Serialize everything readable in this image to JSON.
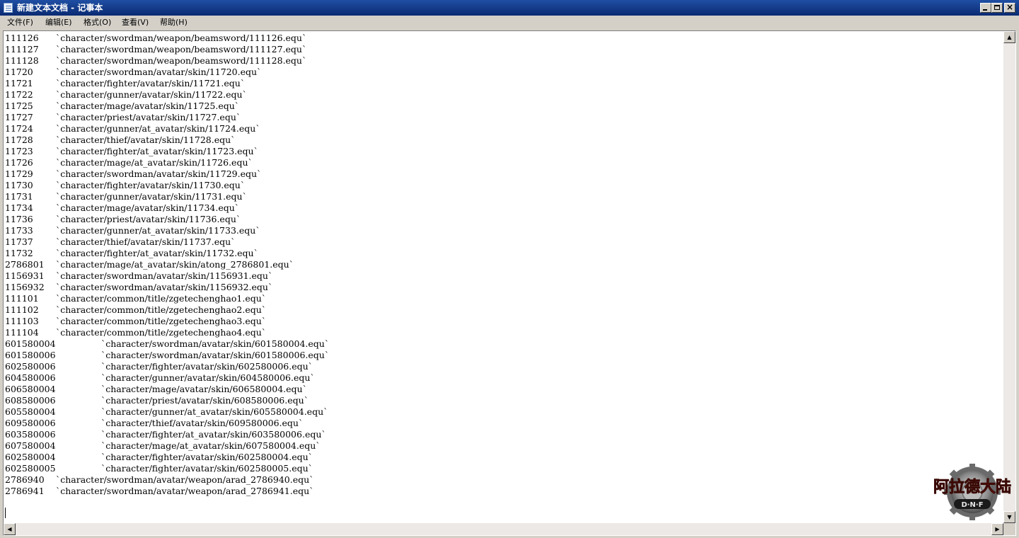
{
  "window": {
    "title": "新建文本文档 - 记事本"
  },
  "controls": {
    "minimize": "_",
    "maximize": "□",
    "close": "×"
  },
  "menu": [
    {
      "label": "文件(F)"
    },
    {
      "label": "编辑(E)"
    },
    {
      "label": "格式(O)"
    },
    {
      "label": "查看(V)"
    },
    {
      "label": "帮助(H)"
    }
  ],
  "lines": [
    {
      "id": "111126",
      "path": "`character/swordman/weapon/beamsword/111126.equ`"
    },
    {
      "id": "111127",
      "path": "`character/swordman/weapon/beamsword/111127.equ`"
    },
    {
      "id": "111128",
      "path": "`character/swordman/weapon/beamsword/111128.equ`"
    },
    {
      "id": "11720",
      "path": "`character/swordman/avatar/skin/11720.equ`"
    },
    {
      "id": "11721",
      "path": "`character/fighter/avatar/skin/11721.equ`"
    },
    {
      "id": "11722",
      "path": "`character/gunner/avatar/skin/11722.equ`"
    },
    {
      "id": "11725",
      "path": "`character/mage/avatar/skin/11725.equ`"
    },
    {
      "id": "11727",
      "path": "`character/priest/avatar/skin/11727.equ`"
    },
    {
      "id": "11724",
      "path": "`character/gunner/at_avatar/skin/11724.equ`"
    },
    {
      "id": "11728",
      "path": "`character/thief/avatar/skin/11728.equ`"
    },
    {
      "id": "11723",
      "path": "`character/fighter/at_avatar/skin/11723.equ`"
    },
    {
      "id": "11726",
      "path": "`character/mage/at_avatar/skin/11726.equ`"
    },
    {
      "id": "11729",
      "path": "`character/swordman/avatar/skin/11729.equ`"
    },
    {
      "id": "11730",
      "path": "`character/fighter/avatar/skin/11730.equ`"
    },
    {
      "id": "11731",
      "path": "`character/gunner/avatar/skin/11731.equ`"
    },
    {
      "id": "11734",
      "path": "`character/mage/avatar/skin/11734.equ`"
    },
    {
      "id": "11736",
      "path": "`character/priest/avatar/skin/11736.equ`"
    },
    {
      "id": "11733",
      "path": "`character/gunner/at_avatar/skin/11733.equ`"
    },
    {
      "id": "11737",
      "path": "`character/thief/avatar/skin/11737.equ`"
    },
    {
      "id": "11732",
      "path": "`character/fighter/at_avatar/skin/11732.equ`"
    },
    {
      "id": "2786801",
      "path": "`character/mage/at_avatar/skin/atong_2786801.equ`"
    },
    {
      "id": "1156931",
      "path": "`character/swordman/avatar/skin/1156931.equ`"
    },
    {
      "id": "1156932",
      "path": "`character/swordman/avatar/skin/1156932.equ`"
    },
    {
      "id": "111101",
      "path": "`character/common/title/zgetechenghao1.equ`"
    },
    {
      "id": "111102",
      "path": "`character/common/title/zgetechenghao2.equ`"
    },
    {
      "id": "111103",
      "path": "`character/common/title/zgetechenghao3.equ`"
    },
    {
      "id": "111104",
      "path": "`character/common/title/zgetechenghao4.equ`"
    },
    {
      "id": "601580004",
      "path": "`character/swordman/avatar/skin/601580004.equ`",
      "wide": true
    },
    {
      "id": "601580006",
      "path": "`character/swordman/avatar/skin/601580006.equ`",
      "wide": true
    },
    {
      "id": "602580006",
      "path": "`character/fighter/avatar/skin/602580006.equ`",
      "wide": true
    },
    {
      "id": "604580006",
      "path": "`character/gunner/avatar/skin/604580006.equ`",
      "wide": true
    },
    {
      "id": "606580004",
      "path": "`character/mage/avatar/skin/606580004.equ`",
      "wide": true
    },
    {
      "id": "608580006",
      "path": "`character/priest/avatar/skin/608580006.equ`",
      "wide": true
    },
    {
      "id": "605580004",
      "path": "`character/gunner/at_avatar/skin/605580004.equ`",
      "wide": true
    },
    {
      "id": "609580006",
      "path": "`character/thief/avatar/skin/609580006.equ`",
      "wide": true
    },
    {
      "id": "603580006",
      "path": "`character/fighter/at_avatar/skin/603580006.equ`",
      "wide": true
    },
    {
      "id": "607580004",
      "path": "`character/mage/at_avatar/skin/607580004.equ`",
      "wide": true
    },
    {
      "id": "602580004",
      "path": "`character/fighter/avatar/skin/602580004.equ`",
      "wide": true
    },
    {
      "id": "602580005",
      "path": "`character/fighter/avatar/skin/602580005.equ`",
      "wide": true
    },
    {
      "id": "2786940",
      "path": "`character/swordman/avatar/weapon/arad_2786940.equ`"
    },
    {
      "id": "2786941",
      "path": "`character/swordman/avatar/weapon/arad_2786941.equ`"
    }
  ],
  "scrollbar": {
    "up": "▲",
    "down": "▼",
    "left": "◀",
    "right": "▶"
  },
  "logo": {
    "text": "阿拉德大陆",
    "sub": "D·N·F",
    "icon": "gear-emblem-icon"
  },
  "colors": {
    "titlebar": "#0a2a72",
    "window_face": "#d4d0c8",
    "editor_bg": "#ffffff",
    "logo_text": "#b41e14"
  }
}
